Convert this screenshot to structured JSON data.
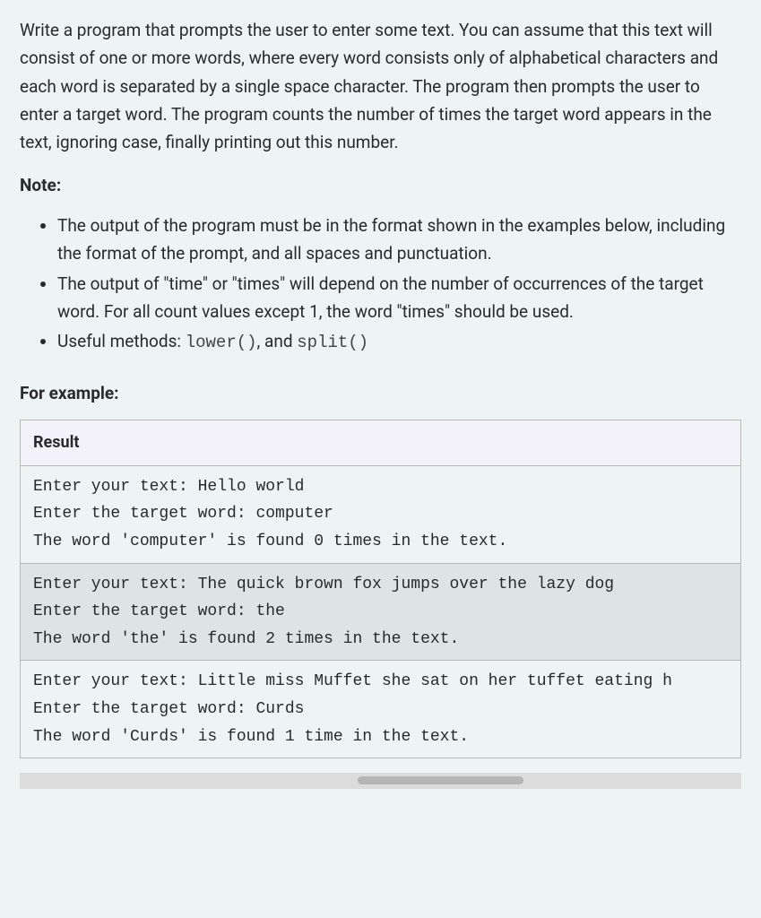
{
  "description": "Write a program that prompts the user to enter some text. You can assume that this text will consist of one or more words, where every word consists only of alphabetical characters and each word is separated by a single space character. The program then prompts the user to enter a target word. The program counts the number of times the target word appears in the text, ignoring case, finally printing out this number.",
  "note_heading": "Note:",
  "notes": {
    "item1": "The output of the program must be in the format shown in the examples below, including the format of the prompt, and all spaces and punctuation.",
    "item2": "The output of \"time\" or \"times\" will depend on the number of occurrences of the target word.  For all count values except 1, the word \"times\" should be used.",
    "item3_prefix": "Useful methods: ",
    "item3_code1": "lower()",
    "item3_mid": ", and ",
    "item3_code2": "split()"
  },
  "example_heading": "For example:",
  "table": {
    "header": "Result",
    "rows": [
      "Enter your text: Hello world\nEnter the target word: computer\nThe word 'computer' is found 0 times in the text.",
      "Enter your text: The quick brown fox jumps over the lazy dog\nEnter the target word: the\nThe word 'the' is found 2 times in the text.",
      "Enter your text: Little miss Muffet she sat on her tuffet eating h\nEnter the target word: Curds\nThe word 'Curds' is found 1 time in the text."
    ]
  }
}
